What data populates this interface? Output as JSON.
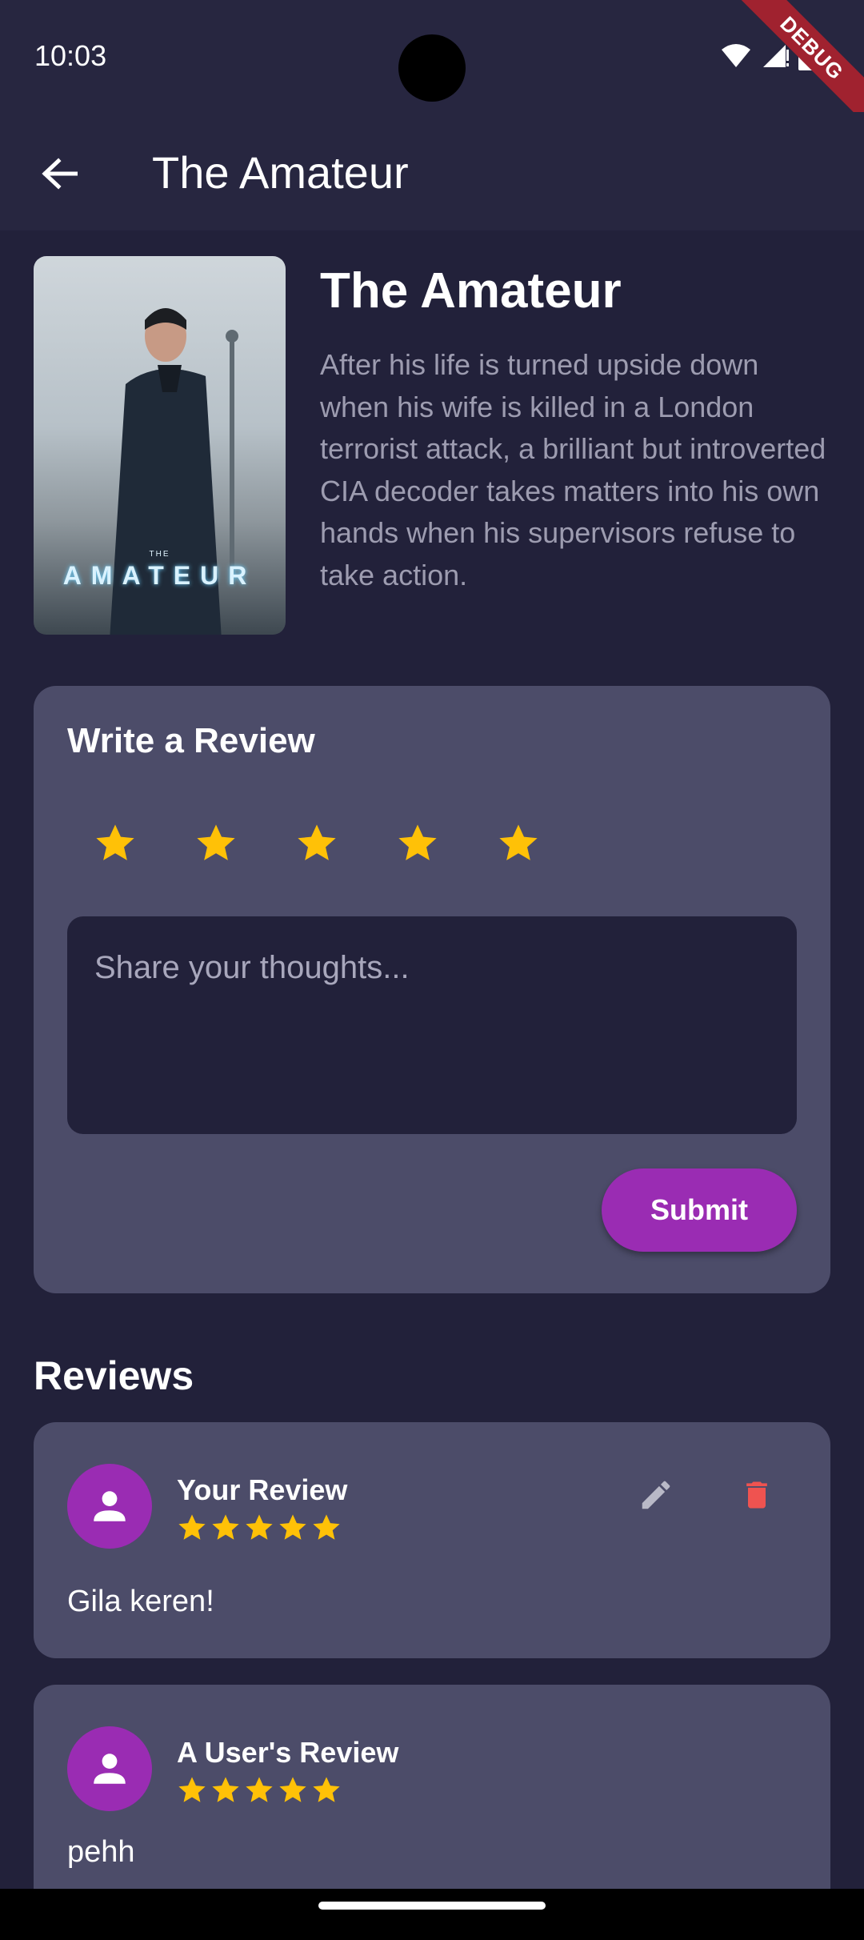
{
  "status_bar": {
    "time": "10:03",
    "debug_label": "DEBUG"
  },
  "app_bar": {
    "title": "The Amateur"
  },
  "movie": {
    "title": "The Amateur",
    "description": "After his life is turned upside down when his wife is killed in a London terrorist attack, a brilliant but introverted CIA decoder takes matters into his own hands when his supervisors refuse to take action.",
    "poster_small_text": "THE",
    "poster_title_text": "AMATEUR"
  },
  "review_form": {
    "heading": "Write a Review",
    "rating": 5,
    "rating_max": 5,
    "placeholder": "Share your thoughts...",
    "value": "",
    "submit_label": "Submit"
  },
  "reviews_section": {
    "heading": "Reviews",
    "items": [
      {
        "author": "Your Review",
        "rating": 5,
        "text": "Gila keren!",
        "editable": true
      },
      {
        "author": "A User's Review",
        "rating": 5,
        "text": "pehh",
        "editable": false
      }
    ]
  },
  "colors": {
    "background": "#22213a",
    "card": "#4c4c69",
    "accent_purple": "#9a2cb3",
    "star": "#ffc107",
    "delete_red": "#ef5350",
    "muted_text": "#9d9cb0"
  },
  "icons": {
    "back": "arrow-left-icon",
    "star": "star-icon",
    "avatar": "person-icon",
    "edit": "pencil-icon",
    "delete": "trash-icon",
    "wifi": "wifi-icon",
    "signal": "signal-icon",
    "battery": "battery-icon"
  }
}
